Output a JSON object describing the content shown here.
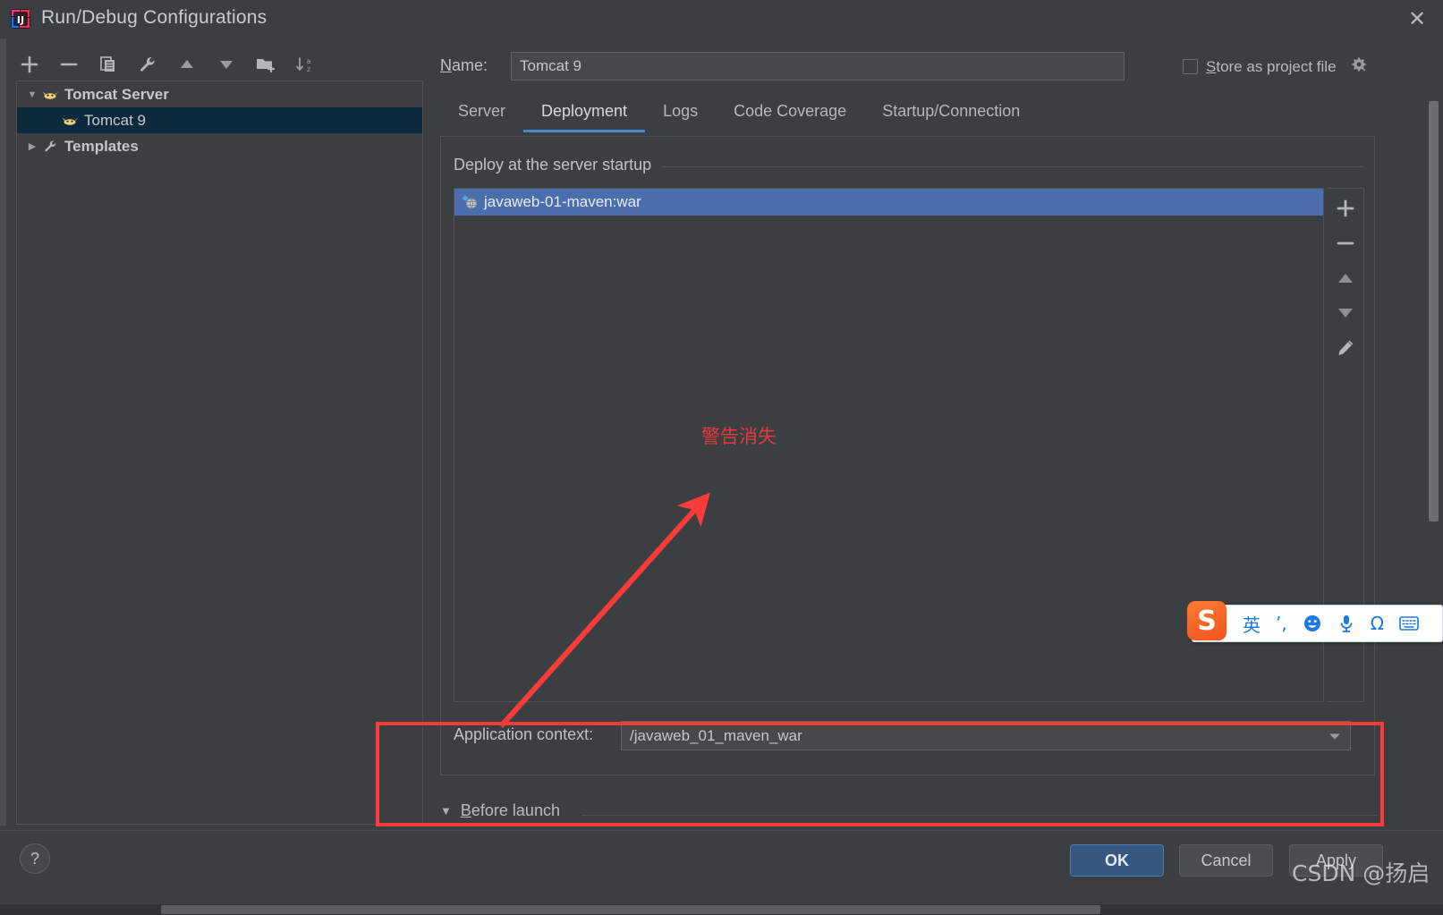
{
  "window": {
    "title": "Run/Debug Configurations",
    "app_icon": "intellij-idea-icon",
    "close_icon": "close-icon"
  },
  "left_toolbar": {
    "buttons": [
      {
        "name": "add-configuration-button",
        "icon": "plus-icon",
        "label": "+"
      },
      {
        "name": "remove-configuration-button",
        "icon": "minus-icon",
        "label": "−"
      },
      {
        "name": "copy-configuration-button",
        "icon": "copy-icon",
        "label": ""
      },
      {
        "name": "edit-templates-button",
        "icon": "wrench-icon",
        "label": ""
      },
      {
        "name": "move-up-button",
        "icon": "arrow-up-icon",
        "label": ""
      },
      {
        "name": "move-down-button",
        "icon": "arrow-down-icon",
        "label": ""
      },
      {
        "name": "new-folder-button",
        "icon": "folder-add-icon",
        "label": ""
      },
      {
        "name": "sort-configurations-button",
        "icon": "sort-az-icon",
        "label": ""
      }
    ]
  },
  "tree": {
    "items": [
      {
        "label": "Tomcat Server",
        "icon": "tomcat-icon",
        "expanded": true,
        "arrow": "▼",
        "selected": false,
        "bold": true,
        "indent": 0
      },
      {
        "label": "Tomcat 9",
        "icon": "tomcat-icon",
        "expanded": false,
        "arrow": "",
        "selected": true,
        "bold": false,
        "indent": 1
      },
      {
        "label": "Templates",
        "icon": "wrench-icon",
        "expanded": false,
        "arrow": "▶",
        "selected": false,
        "bold": true,
        "indent": 0
      }
    ]
  },
  "name_field": {
    "label": "Name:",
    "label_mnemonic": "N",
    "label_rest": "ame:",
    "value": "Tomcat 9"
  },
  "store_as_project_file": {
    "label": "Store as project file",
    "label_mnemonic": "S",
    "label_rest": "tore as project file",
    "checked": false,
    "gear_icon": "gear-dropdown-icon"
  },
  "tabs": [
    {
      "label": "Server",
      "active": false
    },
    {
      "label": "Deployment",
      "active": true
    },
    {
      "label": "Logs",
      "active": false
    },
    {
      "label": "Code Coverage",
      "active": false
    },
    {
      "label": "Startup/Connection",
      "active": false
    }
  ],
  "deployment": {
    "group_title": "Deploy at the server startup",
    "artifacts": [
      {
        "label": "javaweb-01-maven:war",
        "icon": "artifact-war-icon",
        "selected": true
      }
    ],
    "side_actions": [
      {
        "name": "add-artifact-button",
        "icon": "plus-icon",
        "label": "+"
      },
      {
        "name": "remove-artifact-button",
        "icon": "minus-icon",
        "label": "−"
      },
      {
        "name": "move-artifact-up-button",
        "icon": "arrow-up-icon",
        "label": ""
      },
      {
        "name": "move-artifact-down-button",
        "icon": "arrow-down-icon",
        "label": ""
      },
      {
        "name": "edit-artifact-button",
        "icon": "pencil-icon",
        "label": ""
      }
    ]
  },
  "application_context": {
    "label": "Application context:",
    "value": "/javaweb_01_maven_war",
    "dropdown_icon": "chevron-down-icon"
  },
  "before_launch": {
    "label": "Before launch",
    "label_mnemonic": "B",
    "label_rest": "efore launch",
    "expanded": true,
    "arrow": "▼"
  },
  "footer": {
    "help_label": "?",
    "ok_label": "OK",
    "cancel_label": "Cancel",
    "apply_label": "Apply"
  },
  "annotations": {
    "text": "警告消失",
    "color": "#e8393a",
    "rect_color": "#fb3b3b"
  },
  "ime": {
    "logo": "S",
    "items": [
      {
        "label": "英",
        "name": "ime-language-mode"
      },
      {
        "label": "’,",
        "name": "ime-punctuation-toggle"
      },
      {
        "label": "☺",
        "name": "ime-emoji-icon"
      },
      {
        "label": "♁",
        "name": "ime-microphone-icon"
      },
      {
        "label": "Ω",
        "name": "ime-symbol-icon"
      },
      {
        "label": "⌨",
        "name": "ime-keyboard-icon"
      }
    ]
  },
  "watermark": {
    "text": "CSDN @扬启"
  }
}
